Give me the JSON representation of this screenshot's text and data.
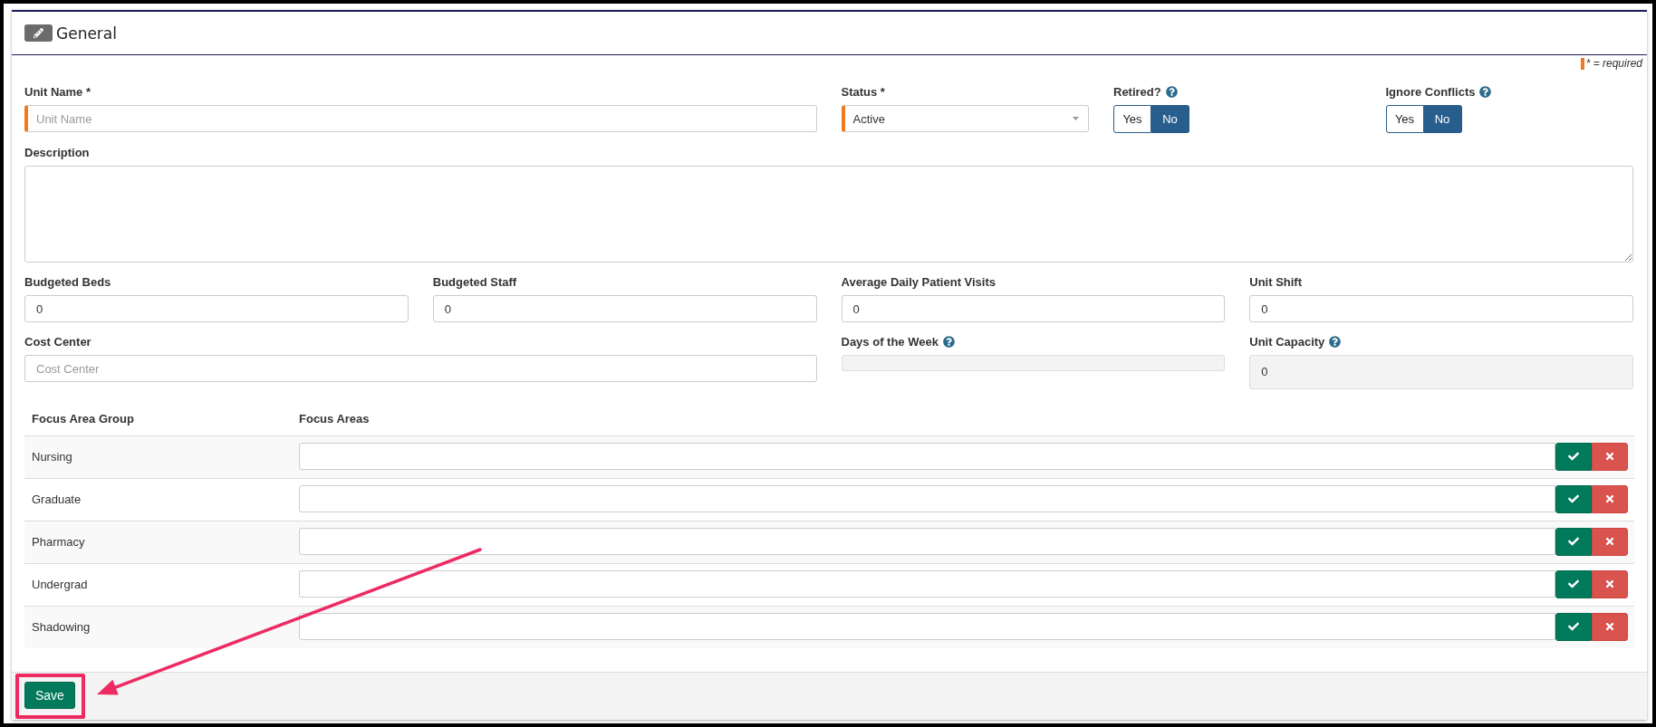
{
  "panel": {
    "title": "General",
    "required_note": "* = required"
  },
  "unit_name": {
    "label": "Unit Name *",
    "placeholder": "Unit Name",
    "required": true,
    "help": false,
    "disabled": false
  },
  "status": {
    "label": "Status *",
    "value": "Active",
    "required": true,
    "help": false
  },
  "retired": {
    "label": "Retired?",
    "help": true,
    "options": [
      {
        "label": "Yes",
        "selected": false
      },
      {
        "label": "No",
        "selected": true
      }
    ]
  },
  "ignore_conflicts": {
    "label": "Ignore Conflicts",
    "help": true,
    "options": [
      {
        "label": "Yes",
        "selected": false
      },
      {
        "label": "No",
        "selected": true
      }
    ]
  },
  "description": {
    "label": "Description",
    "required": false,
    "help": false
  },
  "budgeted_beds": {
    "label": "Budgeted Beds",
    "value": "0",
    "required": false,
    "help": false,
    "disabled": false
  },
  "budgeted_staff": {
    "label": "Budgeted Staff",
    "value": "0",
    "required": false,
    "help": false,
    "disabled": false
  },
  "average_daily_patient_visits": {
    "label": "Average Daily Patient Visits",
    "value": "0",
    "required": false,
    "help": false,
    "disabled": false
  },
  "unit_shift": {
    "label": "Unit Shift",
    "value": "0",
    "required": false,
    "help": false,
    "disabled": false
  },
  "cost_center": {
    "label": "Cost Center",
    "placeholder": "Cost Center",
    "required": false,
    "help": false,
    "disabled": false
  },
  "days_of_the_week": {
    "label": "Days of the Week",
    "required": false,
    "help": true,
    "disabled": true
  },
  "unit_capacity": {
    "label": "Unit Capacity",
    "value": "0",
    "required": false,
    "help": true,
    "disabled": true
  },
  "focus_areas": {
    "columns": [
      "Focus Area Group",
      "Focus Areas"
    ],
    "rows": [
      {
        "group": "Nursing"
      },
      {
        "group": "Graduate"
      },
      {
        "group": "Pharmacy"
      },
      {
        "group": "Undergrad"
      },
      {
        "group": "Shadowing"
      }
    ]
  },
  "footer": {
    "save_button": "Save"
  }
}
